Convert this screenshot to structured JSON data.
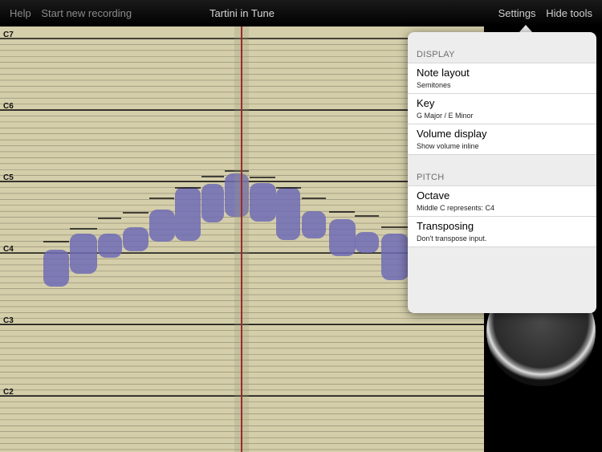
{
  "topbar": {
    "help": "Help",
    "start_recording": "Start new recording",
    "title": "Tartini in Tune",
    "settings": "Settings",
    "hide_tools": "Hide tools"
  },
  "staff": {
    "octave_labels": [
      "C7",
      "C6",
      "C5",
      "C4",
      "C3",
      "C2"
    ]
  },
  "settings_popover": {
    "display_header": "DISPLAY",
    "display_rows": [
      {
        "title": "Note layout",
        "subtitle": "Semitones"
      },
      {
        "title": "Key",
        "subtitle": "G Major / E Minor"
      },
      {
        "title": "Volume display",
        "subtitle": "Show volume inline"
      }
    ],
    "pitch_header": "PITCH",
    "pitch_rows": [
      {
        "title": "Octave",
        "subtitle": "Middle C represents: C4"
      },
      {
        "title": "Transposing",
        "subtitle": "Don't transpose input."
      }
    ]
  },
  "colors": {
    "staff_bg": "#d4ceaa",
    "note_blob": "#6e6bb5",
    "playhead": "#9b2b2b",
    "popover_bg": "#ededed"
  }
}
